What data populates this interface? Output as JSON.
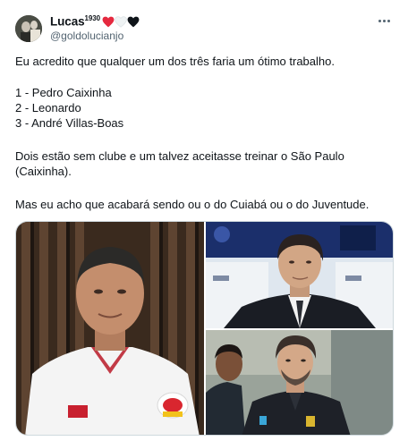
{
  "author": {
    "display_name": "Lucas",
    "superscript": "1930",
    "hearts": [
      "#e5293f",
      "#eff3f4",
      "#0f1419"
    ],
    "handle": "@goldolucianjo"
  },
  "tweet": {
    "line1": "Eu acredito que qualquer um dos três faria um ótimo trabalho.",
    "list": [
      "1 - Pedro Caixinha",
      "2 -  Leonardo",
      "3 - André Villas-Boas"
    ],
    "para2_line1": "Dois estão sem clube e um talvez aceitasse treinar o São Paulo",
    "para2_line2": "(Caixinha).",
    "para3": "Mas eu acho que acabará sendo ou o do Cuiabá ou o do Juventude."
  },
  "media": {
    "photos": [
      "pedro-caixinha-photo",
      "leonardo-photo",
      "villas-boas-photo"
    ]
  },
  "icons": {
    "more": "more-horizontal-icon",
    "heart": "heart-icon"
  }
}
